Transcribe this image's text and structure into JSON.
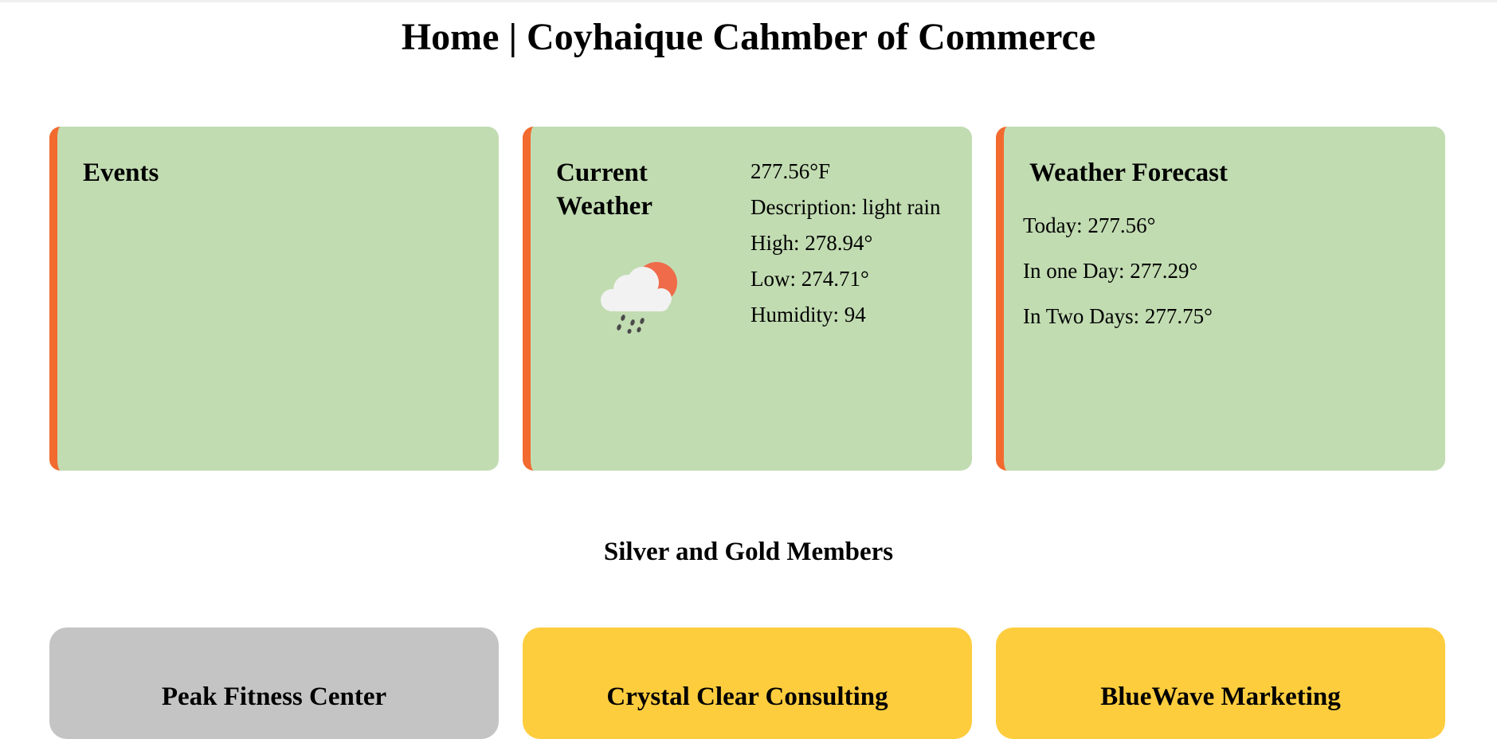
{
  "page": {
    "title": "Home | Coyhaique Cahmber of Commerce"
  },
  "events": {
    "heading": "Events"
  },
  "current_weather": {
    "heading": "Current Weather",
    "icon": "light-rain-cloud-sun-icon",
    "temperature": "277.56°F",
    "description": "Description: light rain",
    "high": "High: 278.94°",
    "low": "Low: 274.71°",
    "humidity": "Humidity: 94"
  },
  "forecast": {
    "heading": "Weather Forecast",
    "items": [
      "Today: 277.56°",
      "In one Day: 277.29°",
      "In Two Days: 277.75°"
    ]
  },
  "members": {
    "heading": "Silver and Gold Members",
    "items": [
      {
        "name": "Peak Fitness Center",
        "level": "silver"
      },
      {
        "name": "Crystal Clear Consulting",
        "level": "gold"
      },
      {
        "name": "BlueWave Marketing",
        "level": "gold"
      }
    ]
  },
  "colors": {
    "card_background": "#c2dcb2",
    "card_accent": "#f26a2e",
    "silver": "#c4c4c4",
    "gold": "#fecd3e"
  }
}
